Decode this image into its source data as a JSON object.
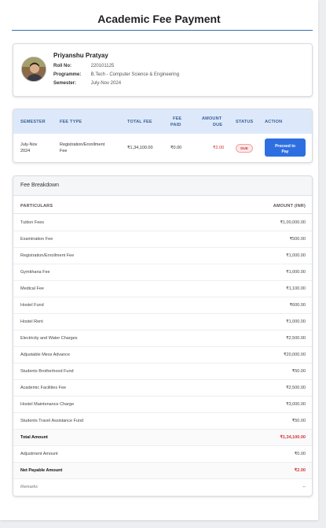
{
  "page": {
    "title": "Academic Fee Payment"
  },
  "student": {
    "name": "Priyanshu Pratyay",
    "fields": [
      {
        "label": "Roll No:",
        "value": "220101125"
      },
      {
        "label": "Programme:",
        "value": "B.Tech - Computer Science & Engineering"
      },
      {
        "label": "Semester:",
        "value": "July-Nov 2024"
      }
    ]
  },
  "summary_table": {
    "headers": {
      "semester": "SEMESTER",
      "fee_type": "FEE TYPE",
      "total_fee": "TOTAL FEE",
      "fee_paid_1": "FEE",
      "fee_paid_2": "PAID",
      "amount_due_1": "AMOUNT",
      "amount_due_2": "DUE",
      "status": "STATUS",
      "action": "ACTION"
    },
    "row": {
      "semester_1": "July-Nov",
      "semester_2": "2024",
      "fee_type_1": "Registration/Enrollment",
      "fee_type_2": "Fee",
      "total_fee": "₹1,34,100.00",
      "fee_paid": "₹0.00",
      "amount_due": "₹2.00",
      "status": "DUE",
      "action_1": "Proceed to",
      "action_2": "Pay"
    }
  },
  "breakdown": {
    "title": "Fee Breakdown",
    "col_particulars": "PARTICULARS",
    "col_amount": "AMOUNT (INR)",
    "rows": [
      {
        "label": "Tuition Fees",
        "amount": "₹1,00,000.00"
      },
      {
        "label": "Examination Fee",
        "amount": "₹500.00"
      },
      {
        "label": "Registration/Enrollment Fee",
        "amount": "₹1,000.00"
      },
      {
        "label": "Gymkhana Fee",
        "amount": "₹1,000.00"
      },
      {
        "label": "Medical Fee",
        "amount": "₹1,100.00"
      },
      {
        "label": "Hostel Fund",
        "amount": "₹600.00"
      },
      {
        "label": "Hostel Rent",
        "amount": "₹1,000.00"
      },
      {
        "label": "Electricity and Water Charges",
        "amount": "₹2,500.00"
      },
      {
        "label": "Adjustable Mess Advance",
        "amount": "₹20,000.00"
      },
      {
        "label": "Students Brotherhood Fund",
        "amount": "₹50.00"
      },
      {
        "label": "Academic Facilities Fee",
        "amount": "₹2,500.00"
      },
      {
        "label": "Hostel Maintenance Charge",
        "amount": "₹3,000.00"
      },
      {
        "label": "Students Travel Assistance Fund",
        "amount": "₹50.00"
      }
    ],
    "total_label": "Total Amount",
    "total_amount": "₹1,34,100.00",
    "adjustment_label": "Adjustment Amount",
    "adjustment_amount": "₹0.00",
    "net_label": "Net Payable Amount",
    "net_amount": "₹2.00",
    "remarks_label": "Remarks",
    "remarks_value": "--"
  },
  "colors": {
    "accent": "#2d6fe0",
    "header_bg": "#dde9fb",
    "due_red": "#d23434"
  }
}
